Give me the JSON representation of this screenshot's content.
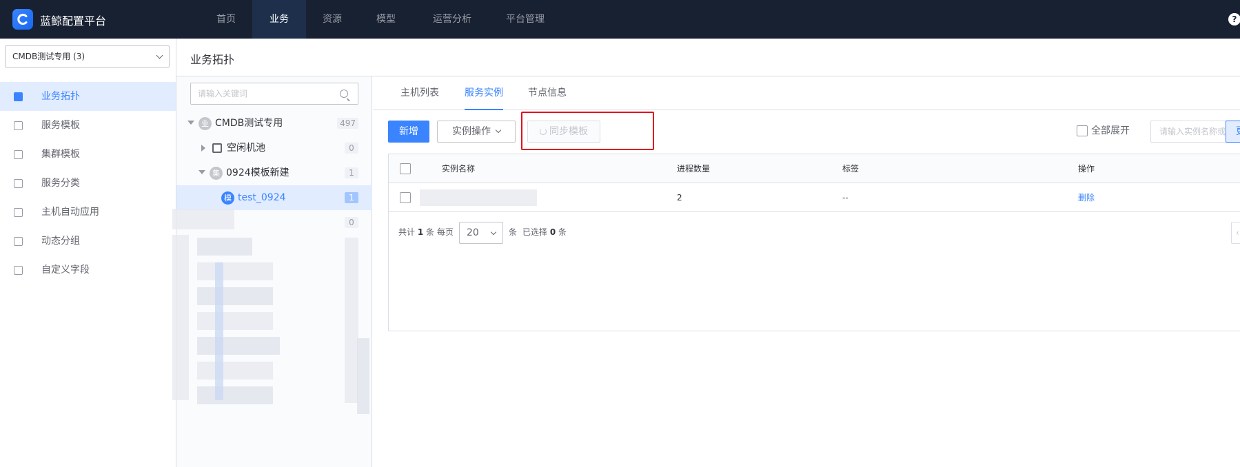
{
  "app": {
    "brand": "蓝鲸配置平台",
    "nav": [
      "首页",
      "业务",
      "资源",
      "模型",
      "运营分析",
      "平台管理"
    ],
    "nav_active": "业务",
    "help": "?"
  },
  "sidebar": {
    "business_select": "CMDB测试专用 (3)",
    "items": [
      {
        "label": "业务拓扑",
        "icon": "topology-icon",
        "active": true
      },
      {
        "label": "服务模板",
        "icon": "cube-icon"
      },
      {
        "label": "集群模板",
        "icon": "cluster-icon"
      },
      {
        "label": "服务分类",
        "icon": "layers-icon"
      },
      {
        "label": "主机自动应用",
        "icon": "auto-apply-icon"
      },
      {
        "label": "动态分组",
        "icon": "dynamic-group-icon"
      },
      {
        "label": "自定义字段",
        "icon": "custom-field-icon"
      }
    ]
  },
  "page": {
    "title": "业务拓扑"
  },
  "tree": {
    "search_placeholder": "请输入关键词",
    "nodes": [
      {
        "icon_text": "业",
        "label": "CMDB测试专用",
        "count": "497"
      },
      {
        "label": "空闲机池",
        "count": "0"
      },
      {
        "icon_text": "集",
        "label": "0924模板新建",
        "count": "1"
      },
      {
        "icon_text": "模",
        "label": "test_0924",
        "count": "1",
        "active": true
      },
      {
        "count": "0"
      }
    ]
  },
  "content": {
    "tabs": [
      "主机列表",
      "服务实例",
      "节点信息"
    ],
    "active_tab": "服务实例",
    "toolbar": {
      "add": "新增",
      "instance_ops": "实例操作",
      "sync_template": "同步模板",
      "expand_all": "全部展开",
      "search_placeholder": "请输入实例名称或选择标签",
      "edge_button": "更"
    },
    "table": {
      "headers": [
        "实例名称",
        "进程数量",
        "标签",
        "操作"
      ],
      "rows": [
        {
          "name": "",
          "process_count": "2",
          "labels": "--",
          "action": "删除"
        }
      ]
    },
    "pagination": {
      "total_prefix": "共计",
      "total": "1",
      "total_suffix": "条",
      "per_page_label": "每页",
      "per_page": "20",
      "per_page_suffix": "条",
      "selected_prefix": "已选择",
      "selected": "0",
      "selected_suffix": "条",
      "prev": "‹"
    }
  },
  "colors": {
    "accent": "#3a84ff",
    "topbar": "#182132",
    "highlight": "#e0101f"
  }
}
